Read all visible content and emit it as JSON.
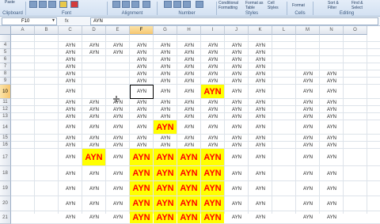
{
  "ribbon": {
    "paste_label": "Paste",
    "clipboard_label": "Clipboard",
    "font_label": "Font",
    "alignment_label": "Alignment",
    "number_label": "Number",
    "styles_label": "Styles",
    "cells_label": "Cells",
    "editing_label": "Editing",
    "conditional_formatting": "Conditional Formatting",
    "format_as_table": "Format as Table",
    "cell_styles": "Cell Styles",
    "format_label": "Format",
    "sort_filter": "Sort & Filter",
    "find_select": "Find & Select"
  },
  "formula_bar": {
    "name_box": "F10",
    "fx": "fx",
    "value": "AYN"
  },
  "sheet": {
    "columns": [
      "A",
      "B",
      "C",
      "D",
      "E",
      "F",
      "G",
      "H",
      "I",
      "J",
      "K",
      "L",
      "M",
      "N",
      "O"
    ],
    "selected_column": "F",
    "rows": [
      "4",
      "5",
      "6",
      "7",
      "8",
      "9",
      "10",
      "11",
      "12",
      "13",
      "14",
      "15",
      "16",
      "17",
      "18",
      "19",
      "20",
      "21"
    ],
    "selected_row": "10",
    "selected_cell": "F10",
    "cell_text": "AYN",
    "highlight_colors": {
      "fill": "#ffff00",
      "text": "#ff0000"
    },
    "cells": {
      "4": {
        "normal": [
          "C",
          "D",
          "E",
          "F",
          "G",
          "H",
          "I",
          "J",
          "K"
        ],
        "big": []
      },
      "5": {
        "normal": [
          "C",
          "D",
          "E",
          "F",
          "G",
          "H",
          "I",
          "J",
          "K"
        ],
        "big": []
      },
      "6": {
        "normal": [
          "C",
          "F",
          "G",
          "H",
          "I",
          "J",
          "K"
        ],
        "big": []
      },
      "7": {
        "normal": [
          "C",
          "F",
          "G",
          "H",
          "I",
          "J",
          "K"
        ],
        "big": []
      },
      "8": {
        "normal": [
          "C",
          "F",
          "G",
          "H",
          "I",
          "J",
          "K",
          "M",
          "N"
        ],
        "big": []
      },
      "9": {
        "normal": [
          "C",
          "F",
          "G",
          "H",
          "I",
          "J",
          "K",
          "M",
          "N"
        ],
        "big": []
      },
      "10": {
        "normal": [
          "C",
          "F",
          "G",
          "H",
          "J",
          "K",
          "M",
          "N"
        ],
        "big": [
          "I"
        ]
      },
      "11": {
        "normal": [
          "C",
          "D",
          "E",
          "F",
          "G",
          "H",
          "I",
          "J",
          "K",
          "M",
          "N"
        ],
        "big": []
      },
      "12": {
        "normal": [
          "C",
          "D",
          "E",
          "F",
          "G",
          "H",
          "I",
          "J",
          "K",
          "M",
          "N"
        ],
        "big": []
      },
      "13": {
        "normal": [
          "C",
          "D",
          "E",
          "F",
          "G",
          "H",
          "I",
          "J",
          "K",
          "M",
          "N"
        ],
        "big": []
      },
      "14": {
        "normal": [
          "C",
          "D",
          "E",
          "F",
          "H",
          "I",
          "J",
          "K",
          "M",
          "N"
        ],
        "big": [
          "G"
        ]
      },
      "15": {
        "normal": [
          "C",
          "D",
          "E",
          "F",
          "G",
          "H",
          "I",
          "J",
          "K",
          "M",
          "N"
        ],
        "big": []
      },
      "16": {
        "normal": [
          "C",
          "D",
          "E",
          "F",
          "G",
          "H",
          "I",
          "J",
          "K",
          "M",
          "N"
        ],
        "big": []
      },
      "17": {
        "normal": [
          "C",
          "E",
          "J",
          "K",
          "M",
          "N"
        ],
        "big": [
          "D",
          "F",
          "G",
          "H",
          "I"
        ]
      },
      "18": {
        "normal": [
          "C",
          "D",
          "E",
          "J",
          "K",
          "M",
          "N"
        ],
        "big": [
          "F",
          "G",
          "H",
          "I"
        ]
      },
      "19": {
        "normal": [
          "C",
          "D",
          "E",
          "J",
          "K",
          "M",
          "N"
        ],
        "big": [
          "F",
          "G",
          "H",
          "I"
        ]
      },
      "20": {
        "normal": [
          "C",
          "D",
          "E",
          "J",
          "K",
          "M",
          "N"
        ],
        "big": [
          "F",
          "G",
          "H",
          "I"
        ]
      },
      "21": {
        "normal": [
          "C",
          "D",
          "E",
          "J",
          "K",
          "M",
          "N"
        ],
        "big": [
          "F",
          "G",
          "H",
          "I"
        ]
      }
    }
  }
}
